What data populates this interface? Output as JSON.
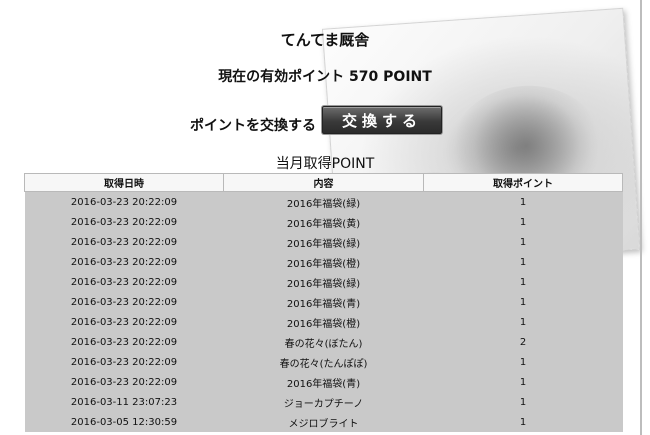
{
  "header": {
    "shop_name": "てんてま厩舎",
    "points_text": "現在の有効ポイント 570 POINT"
  },
  "exchange": {
    "label": "ポイントを交換する",
    "button_label": "交換する"
  },
  "history": {
    "title": "当月取得POINT",
    "columns": [
      "取得日時",
      "内容",
      "取得ポイント"
    ],
    "rows": [
      [
        "2016-03-23 20:22:09",
        "2016年福袋(緑)",
        "1"
      ],
      [
        "2016-03-23 20:22:09",
        "2016年福袋(黄)",
        "1"
      ],
      [
        "2016-03-23 20:22:09",
        "2016年福袋(緑)",
        "1"
      ],
      [
        "2016-03-23 20:22:09",
        "2016年福袋(橙)",
        "1"
      ],
      [
        "2016-03-23 20:22:09",
        "2016年福袋(緑)",
        "1"
      ],
      [
        "2016-03-23 20:22:09",
        "2016年福袋(青)",
        "1"
      ],
      [
        "2016-03-23 20:22:09",
        "2016年福袋(橙)",
        "1"
      ],
      [
        "2016-03-23 20:22:09",
        "春の花々(ぼたん)",
        "2"
      ],
      [
        "2016-03-23 20:22:09",
        "春の花々(たんぽぽ)",
        "1"
      ],
      [
        "2016-03-23 20:22:09",
        "2016年福袋(青)",
        "1"
      ],
      [
        "2016-03-11 23:07:23",
        "ジョーカプチーノ",
        "1"
      ],
      [
        "2016-03-05 12:30:59",
        "メジロブライト",
        "1"
      ]
    ]
  }
}
